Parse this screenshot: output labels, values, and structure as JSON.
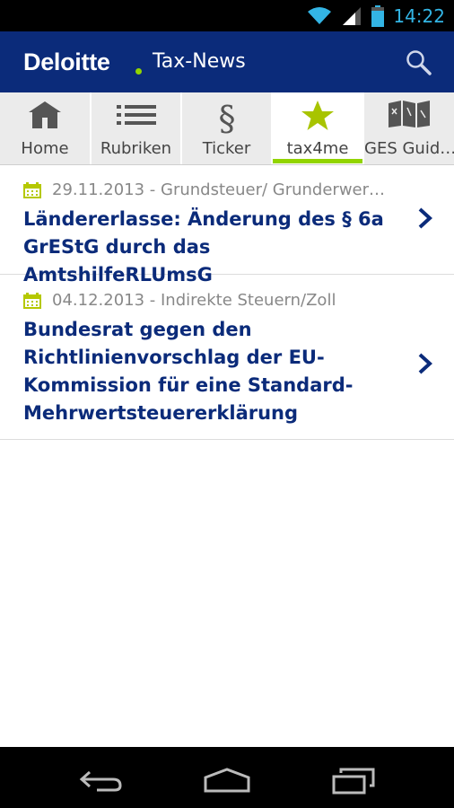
{
  "status_bar": {
    "time": "14:22"
  },
  "header": {
    "brand": "Deloitte",
    "title": "Tax-News",
    "colors": {
      "bar": "#0b2b7a",
      "accent": "#92d400"
    }
  },
  "tabs": [
    {
      "label": "Home",
      "icon": "home-icon"
    },
    {
      "label": "Rubriken",
      "icon": "list-icon"
    },
    {
      "label": "Ticker",
      "icon": "paragraph-icon"
    },
    {
      "label": "tax4me",
      "icon": "star-icon",
      "active": true
    },
    {
      "label": "GES Guid…",
      "icon": "map-icon"
    }
  ],
  "articles": [
    {
      "date": "29.11.2013 - Grundsteuer/ Grunderwer…",
      "title": "Ländererlasse: Änderung des § 6a GrEStG durch das AmtshilfeRLUmsG"
    },
    {
      "date": "04.12.2013 - Indirekte Steuern/Zoll",
      "title": "Bundesrat gegen den Richtlinienvorschlag der EU-Kommission für eine Standard-Mehrwertsteuererklärung"
    }
  ]
}
